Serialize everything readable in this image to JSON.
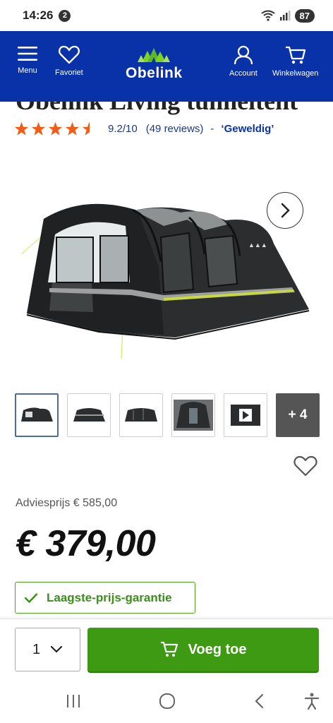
{
  "status": {
    "time": "14:26",
    "notif": "2",
    "battery": "87"
  },
  "header": {
    "menu_label": "Menu",
    "favorites_label": "Favoriet",
    "logo_text": "Obelink",
    "account_label": "Account",
    "cart_label": "Winkelwagen",
    "bg_color": "#0a32a8"
  },
  "product": {
    "title": "Obelink Living tunneltent",
    "rating_stars": 4.5,
    "score": "9.2/10",
    "reviews": "(49 reviews)",
    "separator": "-",
    "verdict": "‘Geweldig’"
  },
  "gallery": {
    "more_label": "+ 4",
    "thumbs": [
      "tent-front",
      "tent-side",
      "tent-side-2",
      "tent-interior",
      "video",
      "more"
    ]
  },
  "pricing": {
    "advice": "Adviesprijs € 585,00",
    "price": "€ 379,00",
    "guarantee": "Laagste-prijs-garantie"
  },
  "cart": {
    "quantity": "1",
    "add_label": "Voeg toe",
    "button_color": "#3d9a12"
  }
}
